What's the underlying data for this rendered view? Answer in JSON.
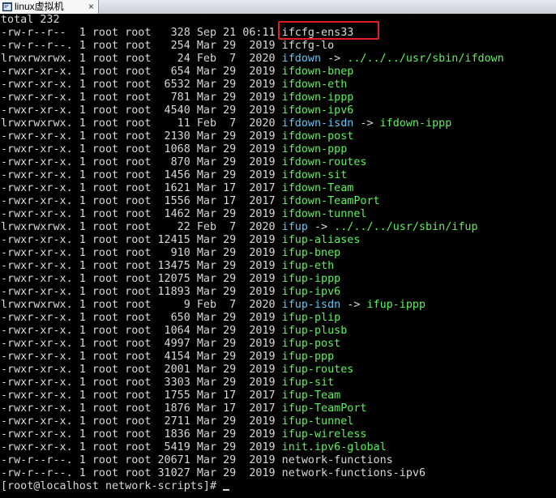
{
  "tab": {
    "label": "linux虚拟机",
    "close": "×"
  },
  "terminal": {
    "total_line": "total 232",
    "prompt": "[root@localhost network-scripts]# ",
    "colors": {
      "default": "#d8d8d8",
      "executable": "#5df05d",
      "symlink": "#5cc8f8",
      "highlight": "#e0201c"
    },
    "entries": [
      {
        "meta": "-rw-r--r--  1 root root   328 Sep 21 06:11 ",
        "name": "ifcfg-ens33",
        "kind": "default"
      },
      {
        "meta": "-rw-r--r--. 1 root root   254 Mar 29  2019 ",
        "name": "ifcfg-lo",
        "kind": "default"
      },
      {
        "meta": "lrwxrwxrwx. 1 root root    24 Feb  7  2020 ",
        "name": "ifdown",
        "kind": "link",
        "arrow": " -> ",
        "target": "../../../usr/sbin/ifdown",
        "target_kind": "exec"
      },
      {
        "meta": "-rwxr-xr-x. 1 root root   654 Mar 29  2019 ",
        "name": "ifdown-bnep",
        "kind": "exec"
      },
      {
        "meta": "-rwxr-xr-x. 1 root root  6532 Mar 29  2019 ",
        "name": "ifdown-eth",
        "kind": "exec"
      },
      {
        "meta": "-rwxr-xr-x. 1 root root   781 Mar 29  2019 ",
        "name": "ifdown-ippp",
        "kind": "exec"
      },
      {
        "meta": "-rwxr-xr-x. 1 root root  4540 Mar 29  2019 ",
        "name": "ifdown-ipv6",
        "kind": "exec"
      },
      {
        "meta": "lrwxrwxrwx. 1 root root    11 Feb  7  2020 ",
        "name": "ifdown-isdn",
        "kind": "link",
        "arrow": " -> ",
        "target": "ifdown-ippp",
        "target_kind": "exec"
      },
      {
        "meta": "-rwxr-xr-x. 1 root root  2130 Mar 29  2019 ",
        "name": "ifdown-post",
        "kind": "exec"
      },
      {
        "meta": "-rwxr-xr-x. 1 root root  1068 Mar 29  2019 ",
        "name": "ifdown-ppp",
        "kind": "exec"
      },
      {
        "meta": "-rwxr-xr-x. 1 root root   870 Mar 29  2019 ",
        "name": "ifdown-routes",
        "kind": "exec"
      },
      {
        "meta": "-rwxr-xr-x. 1 root root  1456 Mar 29  2019 ",
        "name": "ifdown-sit",
        "kind": "exec"
      },
      {
        "meta": "-rwxr-xr-x. 1 root root  1621 Mar 17  2017 ",
        "name": "ifdown-Team",
        "kind": "exec"
      },
      {
        "meta": "-rwxr-xr-x. 1 root root  1556 Mar 17  2017 ",
        "name": "ifdown-TeamPort",
        "kind": "exec"
      },
      {
        "meta": "-rwxr-xr-x. 1 root root  1462 Mar 29  2019 ",
        "name": "ifdown-tunnel",
        "kind": "exec"
      },
      {
        "meta": "lrwxrwxrwx. 1 root root    22 Feb  7  2020 ",
        "name": "ifup",
        "kind": "link",
        "arrow": " -> ",
        "target": "../../../usr/sbin/ifup",
        "target_kind": "exec"
      },
      {
        "meta": "-rwxr-xr-x. 1 root root 12415 Mar 29  2019 ",
        "name": "ifup-aliases",
        "kind": "exec"
      },
      {
        "meta": "-rwxr-xr-x. 1 root root   910 Mar 29  2019 ",
        "name": "ifup-bnep",
        "kind": "exec"
      },
      {
        "meta": "-rwxr-xr-x. 1 root root 13475 Mar 29  2019 ",
        "name": "ifup-eth",
        "kind": "exec"
      },
      {
        "meta": "-rwxr-xr-x. 1 root root 12075 Mar 29  2019 ",
        "name": "ifup-ippp",
        "kind": "exec"
      },
      {
        "meta": "-rwxr-xr-x. 1 root root 11893 Mar 29  2019 ",
        "name": "ifup-ipv6",
        "kind": "exec"
      },
      {
        "meta": "lrwxrwxrwx. 1 root root     9 Feb  7  2020 ",
        "name": "ifup-isdn",
        "kind": "link",
        "arrow": " -> ",
        "target": "ifup-ippp",
        "target_kind": "exec"
      },
      {
        "meta": "-rwxr-xr-x. 1 root root   650 Mar 29  2019 ",
        "name": "ifup-plip",
        "kind": "exec"
      },
      {
        "meta": "-rwxr-xr-x. 1 root root  1064 Mar 29  2019 ",
        "name": "ifup-plusb",
        "kind": "exec"
      },
      {
        "meta": "-rwxr-xr-x. 1 root root  4997 Mar 29  2019 ",
        "name": "ifup-post",
        "kind": "exec"
      },
      {
        "meta": "-rwxr-xr-x. 1 root root  4154 Mar 29  2019 ",
        "name": "ifup-ppp",
        "kind": "exec"
      },
      {
        "meta": "-rwxr-xr-x. 1 root root  2001 Mar 29  2019 ",
        "name": "ifup-routes",
        "kind": "exec"
      },
      {
        "meta": "-rwxr-xr-x. 1 root root  3303 Mar 29  2019 ",
        "name": "ifup-sit",
        "kind": "exec"
      },
      {
        "meta": "-rwxr-xr-x. 1 root root  1755 Mar 17  2017 ",
        "name": "ifup-Team",
        "kind": "exec"
      },
      {
        "meta": "-rwxr-xr-x. 1 root root  1876 Mar 17  2017 ",
        "name": "ifup-TeamPort",
        "kind": "exec"
      },
      {
        "meta": "-rwxr-xr-x. 1 root root  2711 Mar 29  2019 ",
        "name": "ifup-tunnel",
        "kind": "exec"
      },
      {
        "meta": "-rwxr-xr-x. 1 root root  1836 Mar 29  2019 ",
        "name": "ifup-wireless",
        "kind": "exec"
      },
      {
        "meta": "-rwxr-xr-x. 1 root root  5419 Mar 29  2019 ",
        "name": "init.ipv6-global",
        "kind": "exec"
      },
      {
        "meta": "-rw-r--r--. 1 root root 20671 Mar 29  2019 ",
        "name": "network-functions",
        "kind": "default"
      },
      {
        "meta": "-rw-r--r--. 1 root root 31027 Mar 29  2019 ",
        "name": "network-functions-ipv6",
        "kind": "default"
      }
    ]
  }
}
